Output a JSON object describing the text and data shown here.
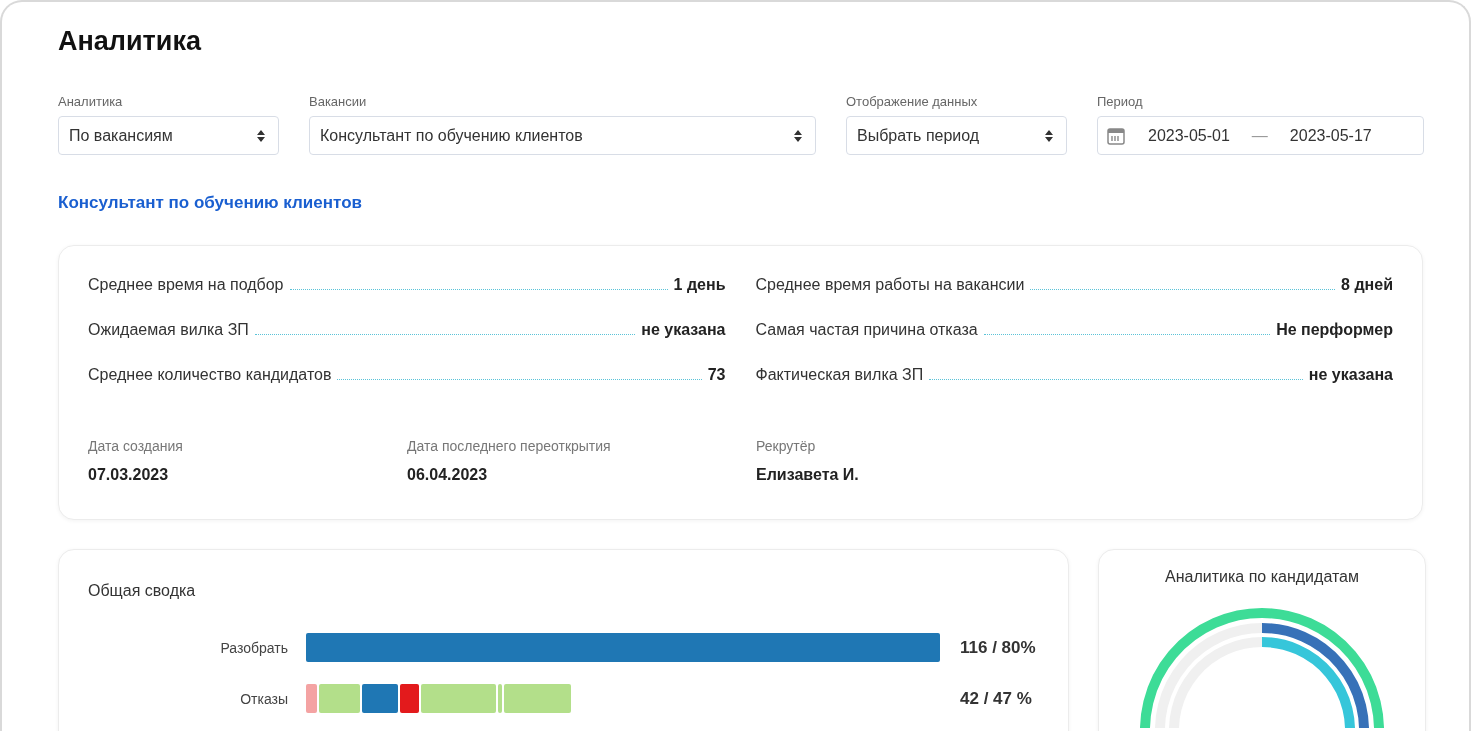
{
  "page_title": "Аналитика",
  "filters": [
    {
      "kind": "select",
      "label": "Аналитика",
      "value": "По вакансиям"
    },
    {
      "kind": "select",
      "label": "Вакансии",
      "value": "Консультант по обучению клиентов"
    },
    {
      "kind": "select",
      "label": "Отображение данных",
      "value": "Выбрать период"
    },
    {
      "kind": "daterange",
      "label": "Период",
      "from": "2023-05-01",
      "separator": "—",
      "to": "2023-05-17"
    }
  ],
  "vacancy_title": "Консультант по обучению клиентов",
  "stats_left": [
    {
      "label": "Среднее время на подбор",
      "value": "1 день"
    },
    {
      "label": "Ожидаемая вилка ЗП",
      "value": "не указана"
    },
    {
      "label": "Среднее количество кандидатов",
      "value": "73"
    }
  ],
  "stats_right": [
    {
      "label": "Среднее время работы на вакансии",
      "value": "8 дней"
    },
    {
      "label": "Самая частая причина отказа",
      "value": "Не перформер"
    },
    {
      "label": "Фактическая вилка ЗП",
      "value": "не указана"
    }
  ],
  "details": [
    {
      "label": "Дата создания",
      "value": "07.03.2023"
    },
    {
      "label": "Дата последнего переоткрытия",
      "value": "06.04.2023"
    },
    {
      "label": "Рекрутёр",
      "value": "Елизавета И."
    }
  ],
  "summary": {
    "title": "Общая сводка",
    "rows": [
      {
        "label": "Разобрать",
        "reading": "116 / 80%",
        "segments": [
          {
            "color": "#1f77b4"
          }
        ]
      },
      {
        "label": "Отказы",
        "reading": "42 / 47 %",
        "segments": [
          {
            "color": "#f4a3a3"
          },
          {
            "color": "#b3df8a"
          },
          {
            "color": "#1f77b4"
          },
          {
            "color": "#e31a1c"
          },
          {
            "color": "#b3df8a"
          },
          {
            "color": "#b3df8a"
          },
          {
            "color": "#b3df8a"
          }
        ]
      }
    ]
  },
  "candidates": {
    "title": "Аналитика по кандидатам"
  }
}
